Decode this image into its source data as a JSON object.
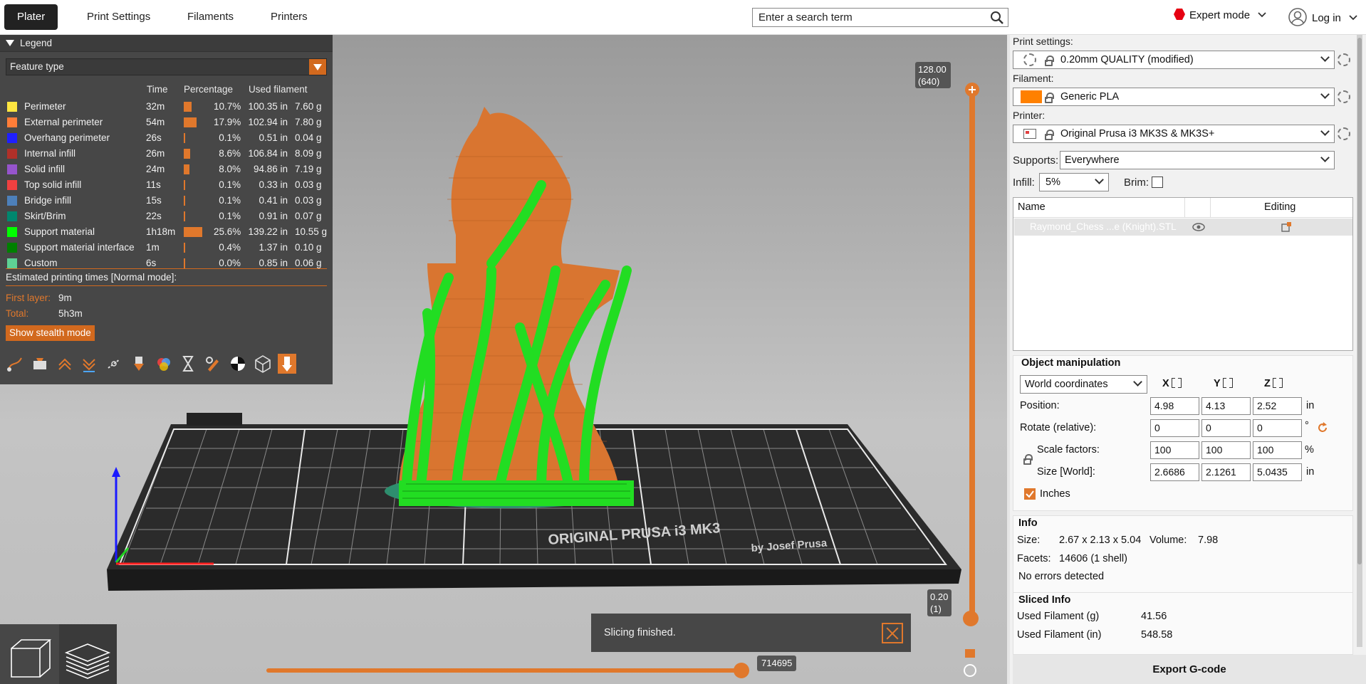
{
  "topbar": {
    "tabs": [
      {
        "label": "Plater",
        "active": true
      },
      {
        "label": "Print Settings",
        "active": false
      },
      {
        "label": "Filaments",
        "active": false
      },
      {
        "label": "Printers",
        "active": false
      }
    ],
    "search_placeholder": "Enter a search term",
    "mode_label": "Expert mode",
    "mode_color": "#e60012",
    "login_label": "Log in"
  },
  "legend": {
    "title": "Legend",
    "view_type": "Feature type",
    "columns": {
      "time": "Time",
      "percentage": "Percentage",
      "used_filament": "Used filament"
    },
    "rows": [
      {
        "name": "Perimeter",
        "color": "#ffe640",
        "time": "32m",
        "percent": 10.7,
        "percent_label": "10.7%",
        "in": "100.35 in",
        "g": "7.60 g"
      },
      {
        "name": "External perimeter",
        "color": "#ff7d38",
        "time": "54m",
        "percent": 17.9,
        "percent_label": "17.9%",
        "in": "102.94 in",
        "g": "7.80 g"
      },
      {
        "name": "Overhang perimeter",
        "color": "#1f1fff",
        "time": "26s",
        "percent": 0.1,
        "percent_label": "0.1%",
        "in": "0.51 in",
        "g": "0.04 g"
      },
      {
        "name": "Internal infill",
        "color": "#b03029",
        "time": "26m",
        "percent": 8.6,
        "percent_label": "8.6%",
        "in": "106.84 in",
        "g": "8.09 g"
      },
      {
        "name": "Solid infill",
        "color": "#9654cc",
        "time": "24m",
        "percent": 8.0,
        "percent_label": "8.0%",
        "in": "94.86 in",
        "g": "7.19 g"
      },
      {
        "name": "Top solid infill",
        "color": "#f04040",
        "time": "11s",
        "percent": 0.1,
        "percent_label": "0.1%",
        "in": "0.33 in",
        "g": "0.03 g"
      },
      {
        "name": "Bridge infill",
        "color": "#4d80ba",
        "time": "15s",
        "percent": 0.1,
        "percent_label": "0.1%",
        "in": "0.41 in",
        "g": "0.03 g"
      },
      {
        "name": "Skirt/Brim",
        "color": "#00876e",
        "time": "22s",
        "percent": 0.1,
        "percent_label": "0.1%",
        "in": "0.91 in",
        "g": "0.07 g"
      },
      {
        "name": "Support material",
        "color": "#00ff00",
        "time": "1h18m",
        "percent": 25.6,
        "percent_label": "25.6%",
        "in": "139.22 in",
        "g": "10.55 g"
      },
      {
        "name": "Support material interface",
        "color": "#008000",
        "time": "1m",
        "percent": 0.4,
        "percent_label": "0.4%",
        "in": "1.37 in",
        "g": "0.10 g"
      },
      {
        "name": "Custom",
        "color": "#5ed194",
        "time": "6s",
        "percent": 0.0,
        "percent_label": "0.0%",
        "in": "0.85 in",
        "g": "0.06 g"
      }
    ],
    "estimated_title": "Estimated printing times [Normal mode]:",
    "first_layer_label": "First layer:",
    "first_layer_value": "9m",
    "total_label": "Total:",
    "total_value": "5h3m",
    "stealth_button": "Show stealth mode",
    "accent_color": "#d2691e"
  },
  "viewport": {
    "layer_top_value": "128.00",
    "layer_top_index": "(640)",
    "layer_bottom_value": "0.20",
    "layer_bottom_index": "(1)",
    "move_value": "714695",
    "notification": "Slicing finished.",
    "bed_text_line1": "ORIGINAL PRUSA i3 MK3",
    "bed_text_line2": "by Josef Prusa"
  },
  "sidebar": {
    "print_settings_label": "Print settings:",
    "print_settings_value": "0.20mm QUALITY (modified)",
    "filament_label": "Filament:",
    "filament_value": "Generic PLA",
    "filament_color": "#ff8000",
    "printer_label": "Printer:",
    "printer_value": "Original Prusa i3 MK3S & MK3S+",
    "supports_label": "Supports:",
    "supports_value": "Everywhere",
    "infill_label": "Infill:",
    "infill_value": "5%",
    "brim_label": "Brim:",
    "list_header_name": "Name",
    "list_header_editing": "Editing",
    "object_name": "Raymond_Chess ...e (Knight).STL",
    "object_manipulation": {
      "title": "Object manipulation",
      "coord_system": "World coordinates",
      "axes": [
        "X",
        "Y",
        "Z"
      ],
      "position_label": "Position:",
      "position": [
        "4.98",
        "4.13",
        "2.52"
      ],
      "position_unit": "in",
      "rotate_label": "Rotate (relative):",
      "rotate": [
        "0",
        "0",
        "0"
      ],
      "rotate_unit": "°",
      "scale_label": "Scale factors:",
      "scale": [
        "100",
        "100",
        "100"
      ],
      "scale_unit": "%",
      "size_label": "Size [World]:",
      "size": [
        "2.6686",
        "2.1261",
        "5.0435"
      ],
      "size_unit": "in",
      "inches_label": "Inches"
    },
    "info": {
      "title": "Info",
      "size_label": "Size:",
      "size_value": "2.67 x 2.13 x 5.04",
      "volume_label": "Volume:",
      "volume_value": "7.98",
      "facets_label": "Facets:",
      "facets_value": "14606 (1 shell)",
      "errors": "No errors detected"
    },
    "sliced_info": {
      "title": "Sliced Info",
      "used_g_label": "Used Filament (g)",
      "used_g_value": "41.56",
      "used_in_label": "Used Filament (in)",
      "used_in_value": "548.58"
    },
    "export_label": "Export G-code"
  }
}
